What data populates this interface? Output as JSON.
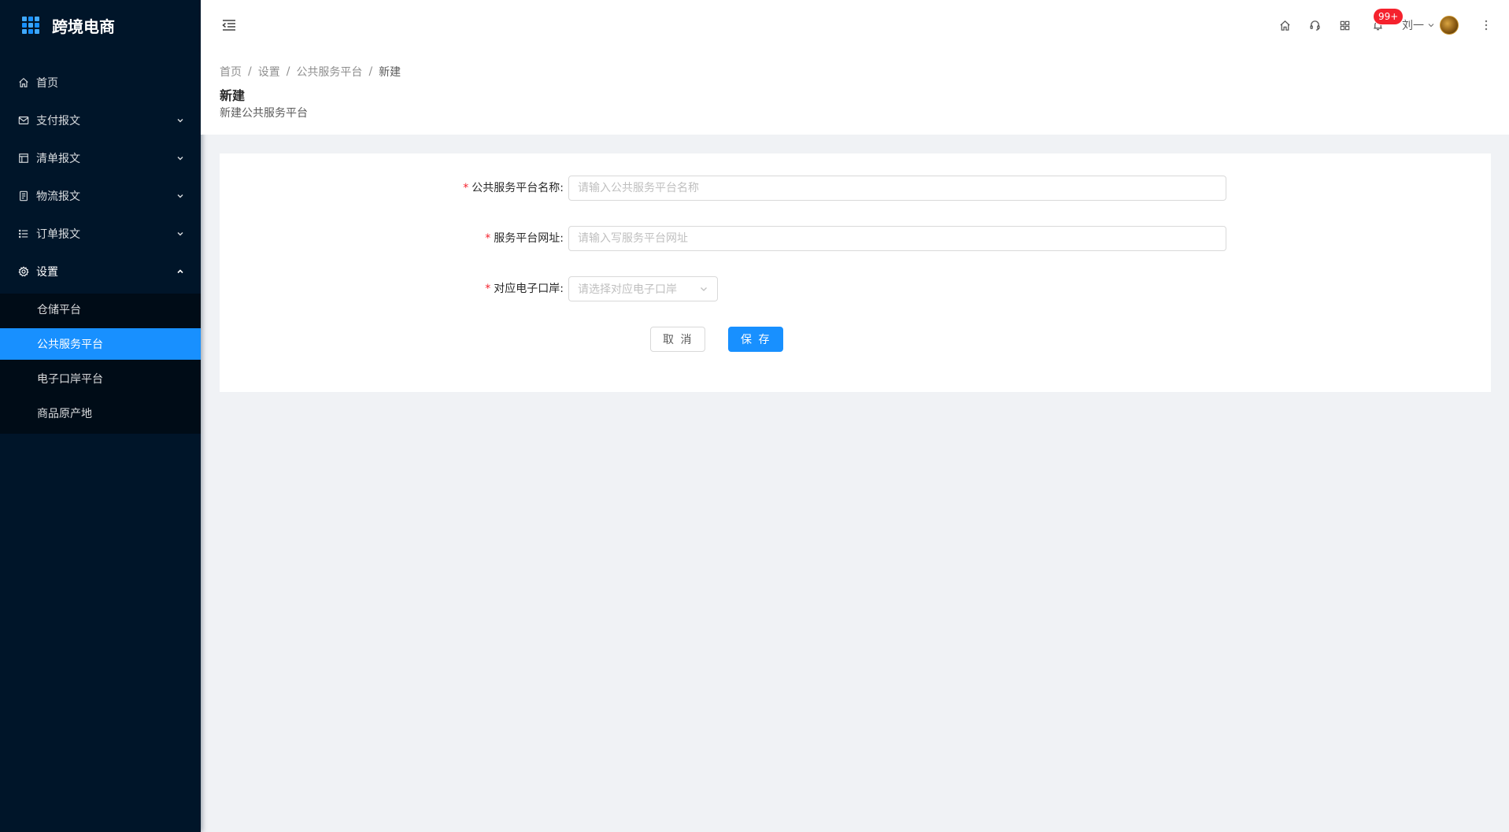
{
  "app": {
    "title": "跨境电商"
  },
  "sidebar": {
    "items": [
      {
        "label": "首页",
        "icon": "home-icon",
        "has_children": false
      },
      {
        "label": "支付报文",
        "icon": "mail-icon",
        "has_children": true
      },
      {
        "label": "清单报文",
        "icon": "layout-icon",
        "has_children": true
      },
      {
        "label": "物流报文",
        "icon": "file-icon",
        "has_children": true
      },
      {
        "label": "订单报文",
        "icon": "list-icon",
        "has_children": true
      },
      {
        "label": "设置",
        "icon": "setting-icon",
        "has_children": true,
        "open": true
      }
    ],
    "submenu": [
      {
        "label": "仓储平台",
        "active": false
      },
      {
        "label": "公共服务平台",
        "active": true
      },
      {
        "label": "电子口岸平台",
        "active": false
      },
      {
        "label": "商品原产地",
        "active": false
      }
    ]
  },
  "header": {
    "icons": [
      "home-icon",
      "customer-service-icon",
      "apps-icon",
      "bell-icon"
    ],
    "notification_badge": "99+",
    "user_name": "刘一"
  },
  "breadcrumb": [
    "首页",
    "设置",
    "公共服务平台",
    "新建"
  ],
  "breadcrumb_separator": "/",
  "page": {
    "title": "新建",
    "description": "新建公共服务平台"
  },
  "form": {
    "fields": [
      {
        "label": "公共服务平台名称:",
        "placeholder": "请输入公共服务平台名称",
        "value": "",
        "required": true
      },
      {
        "label": "服务平台网址:",
        "placeholder": "请输入写服务平台网址",
        "value": "",
        "required": true
      },
      {
        "label": "对应电子口岸:",
        "placeholder": "请选择对应电子口岸",
        "value": "",
        "required": true,
        "type": "select"
      }
    ],
    "required_mark": "*",
    "cancel_label": "取 消",
    "save_label": "保 存"
  },
  "colors": {
    "sidebar_bg": "#001529",
    "submenu_bg": "#000c17",
    "primary": "#1890ff",
    "badge": "#f5222d",
    "page_bg": "#f0f2f5"
  }
}
